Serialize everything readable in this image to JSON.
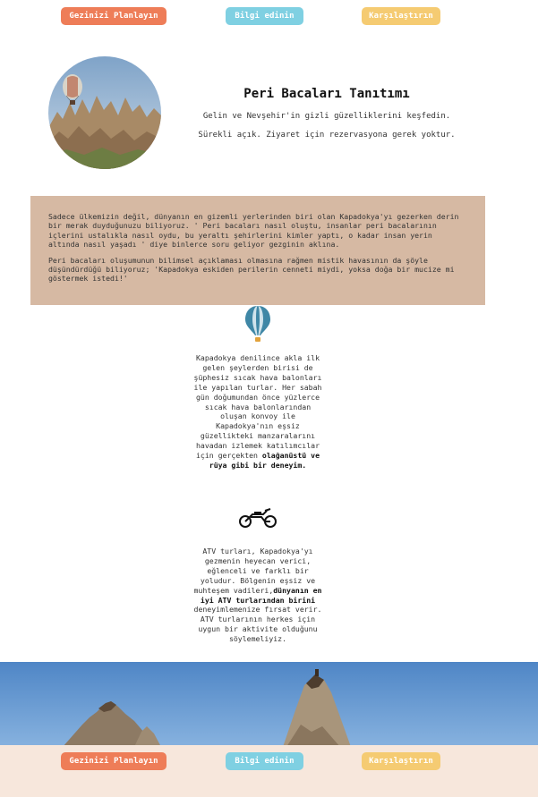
{
  "nav": {
    "plan_label": "Gezinizi Planlayın",
    "info_label": "Bilgi edinin",
    "compare_label": "Karşılaştırın"
  },
  "hero": {
    "title": "Peri Bacaları Tanıtımı",
    "subtitle": "Gelin ve Nevşehir'in gizli güzelliklerini keşfedin.",
    "note": "Sürekli açık. Ziyaret için rezervasyona gerek yoktur."
  },
  "intro": {
    "paragraph1": "Sadece ülkemizin değil, dünyanın en gizemli yerlerinden biri olan Kapadokya'yı gezerken derin bir merak duyduğunuzu biliyoruz. ' Peri bacaları nasıl oluştu, insanlar peri bacalarının içlerini ustalıkla nasıl oydu, bu yeraltı şehirlerini kimler yaptı, o kadar insan yerin altında nasıl yaşadı ' diye binlerce soru geliyor gezginin aklına.",
    "paragraph2": "Peri bacaları oluşumunun bilimsel açıklaması olmasına rağmen mistik havasının da şöyle düşündürdüğü biliyoruz; 'Kapadokya eskiden perilerin cenneti miydi, yoksa doğa bir mucize mi göstermek istedi!'"
  },
  "balloon_section": {
    "icon": "hot-air-balloon-icon",
    "text": "Kapadokya denilince akla ilk gelen şeylerden birisi de şüphesiz sıcak hava balonları ile yapılan turlar. Her sabah gün doğumundan önce yüzlerce sıcak hava balonlarından oluşan konvoy ile Kapadokya'nın eşsiz güzellikteki manzaralarını havadan izlemek katılımcılar için gerçekten ",
    "highlight": "olağanüstü ve rüya gibi bir deneyim."
  },
  "atv_section": {
    "icon": "motorcycle-icon",
    "text_before": "ATV turları, Kapadokya'yı gezmenin heyecan verici, eğlenceli ve farklı bir yoludur. Bölgenin eşsiz ve muhteşem vadileri,",
    "highlight": "dünyanın en iyi ATV turlarından birini",
    "text_after": " deneyimlemenize fırsat verir. ATV turlarının herkes için uygun bir aktivite olduğunu söylemeliyiz."
  },
  "colors": {
    "plan": "#ee7d58",
    "info": "#7fd0e2",
    "compare": "#f5cb72",
    "intro_bg": "#d6b9a3",
    "footer_bg": "#f7e7dc"
  }
}
